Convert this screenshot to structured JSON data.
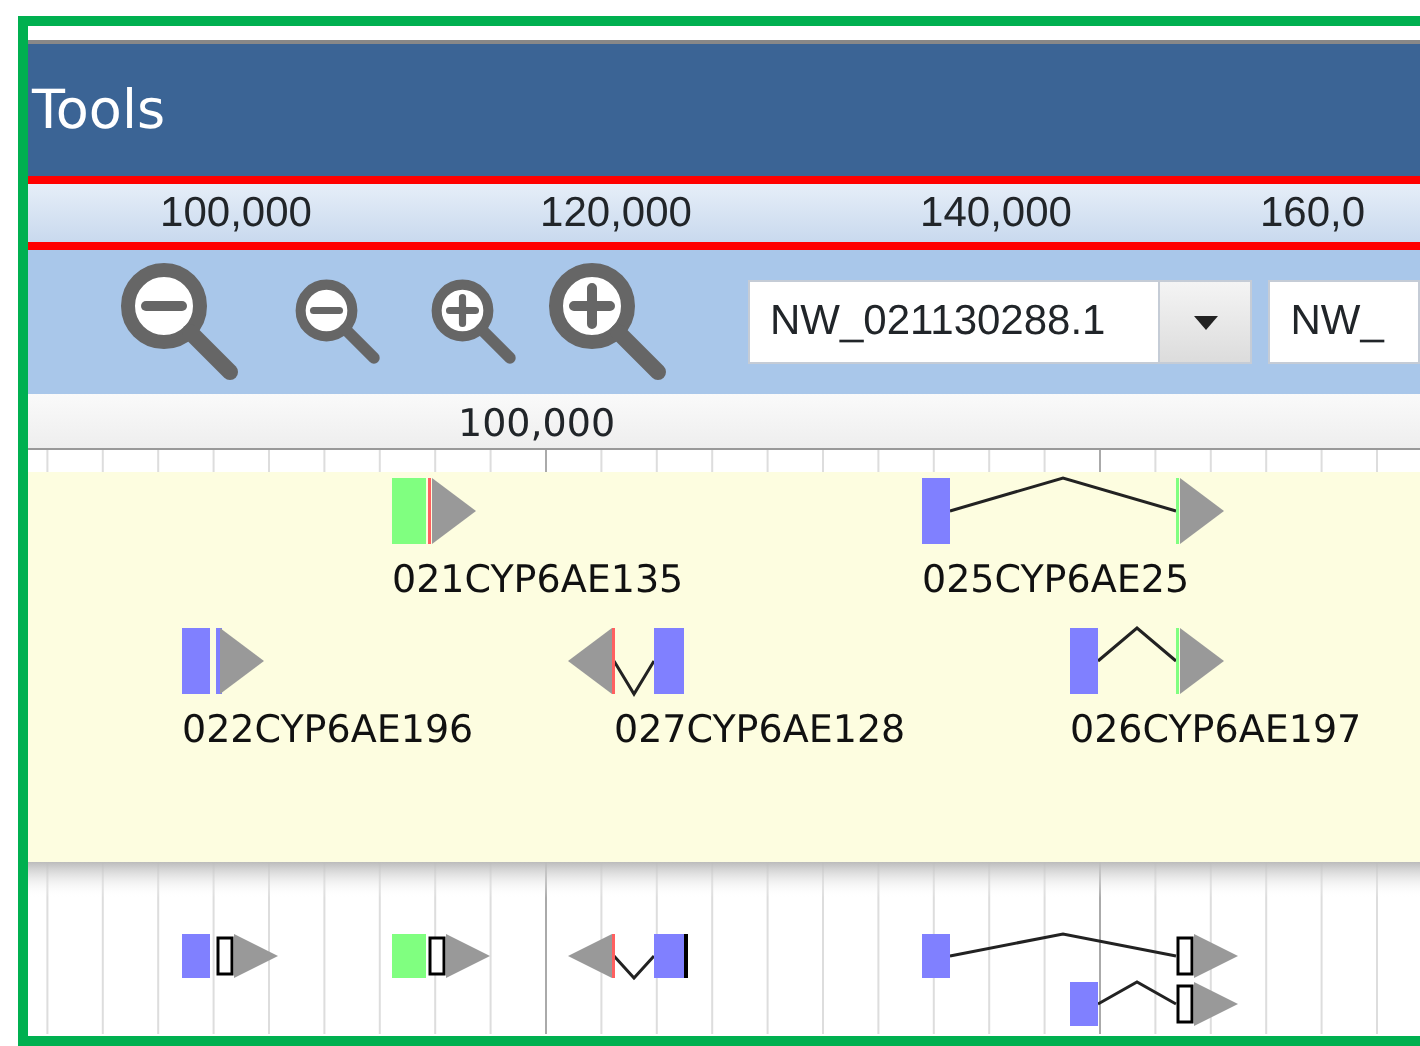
{
  "title": "Tools",
  "overview_ticks": [
    "100,000",
    "120,000",
    "140,000",
    "160,0"
  ],
  "zoom_buttons": [
    {
      "kind": "zoom-out",
      "large": true
    },
    {
      "kind": "zoom-out",
      "large": false
    },
    {
      "kind": "zoom-in",
      "large": false
    },
    {
      "kind": "zoom-in",
      "large": true
    }
  ],
  "selects": [
    {
      "value": "NW_021130288.1",
      "dropdown": true
    },
    {
      "value": "NW_",
      "dropdown": false
    }
  ],
  "scale_ticks": [
    "100,000"
  ],
  "gene_track": {
    "features": [
      {
        "name": "021CYP6AE135",
        "reverse": false,
        "color": "#80ff80"
      },
      {
        "name": "025CYP6AE25",
        "reverse": false,
        "color": "#8080ff"
      },
      {
        "name": "022CYP6AE196",
        "reverse": false,
        "color": "#8080ff"
      },
      {
        "name": "027CYP6AE128",
        "reverse": true,
        "color": "#8080ff"
      },
      {
        "name": "026CYP6AE197",
        "reverse": false,
        "color": "#8080ff"
      }
    ]
  },
  "lower_track": {
    "features": [
      {
        "reverse": false,
        "color": "#8080ff"
      },
      {
        "reverse": false,
        "color": "#80ff80"
      },
      {
        "reverse": true,
        "color": "#8080ff"
      },
      {
        "reverse": false,
        "color": "#8080ff"
      },
      {
        "reverse": false,
        "color": "#8080ff"
      }
    ]
  }
}
